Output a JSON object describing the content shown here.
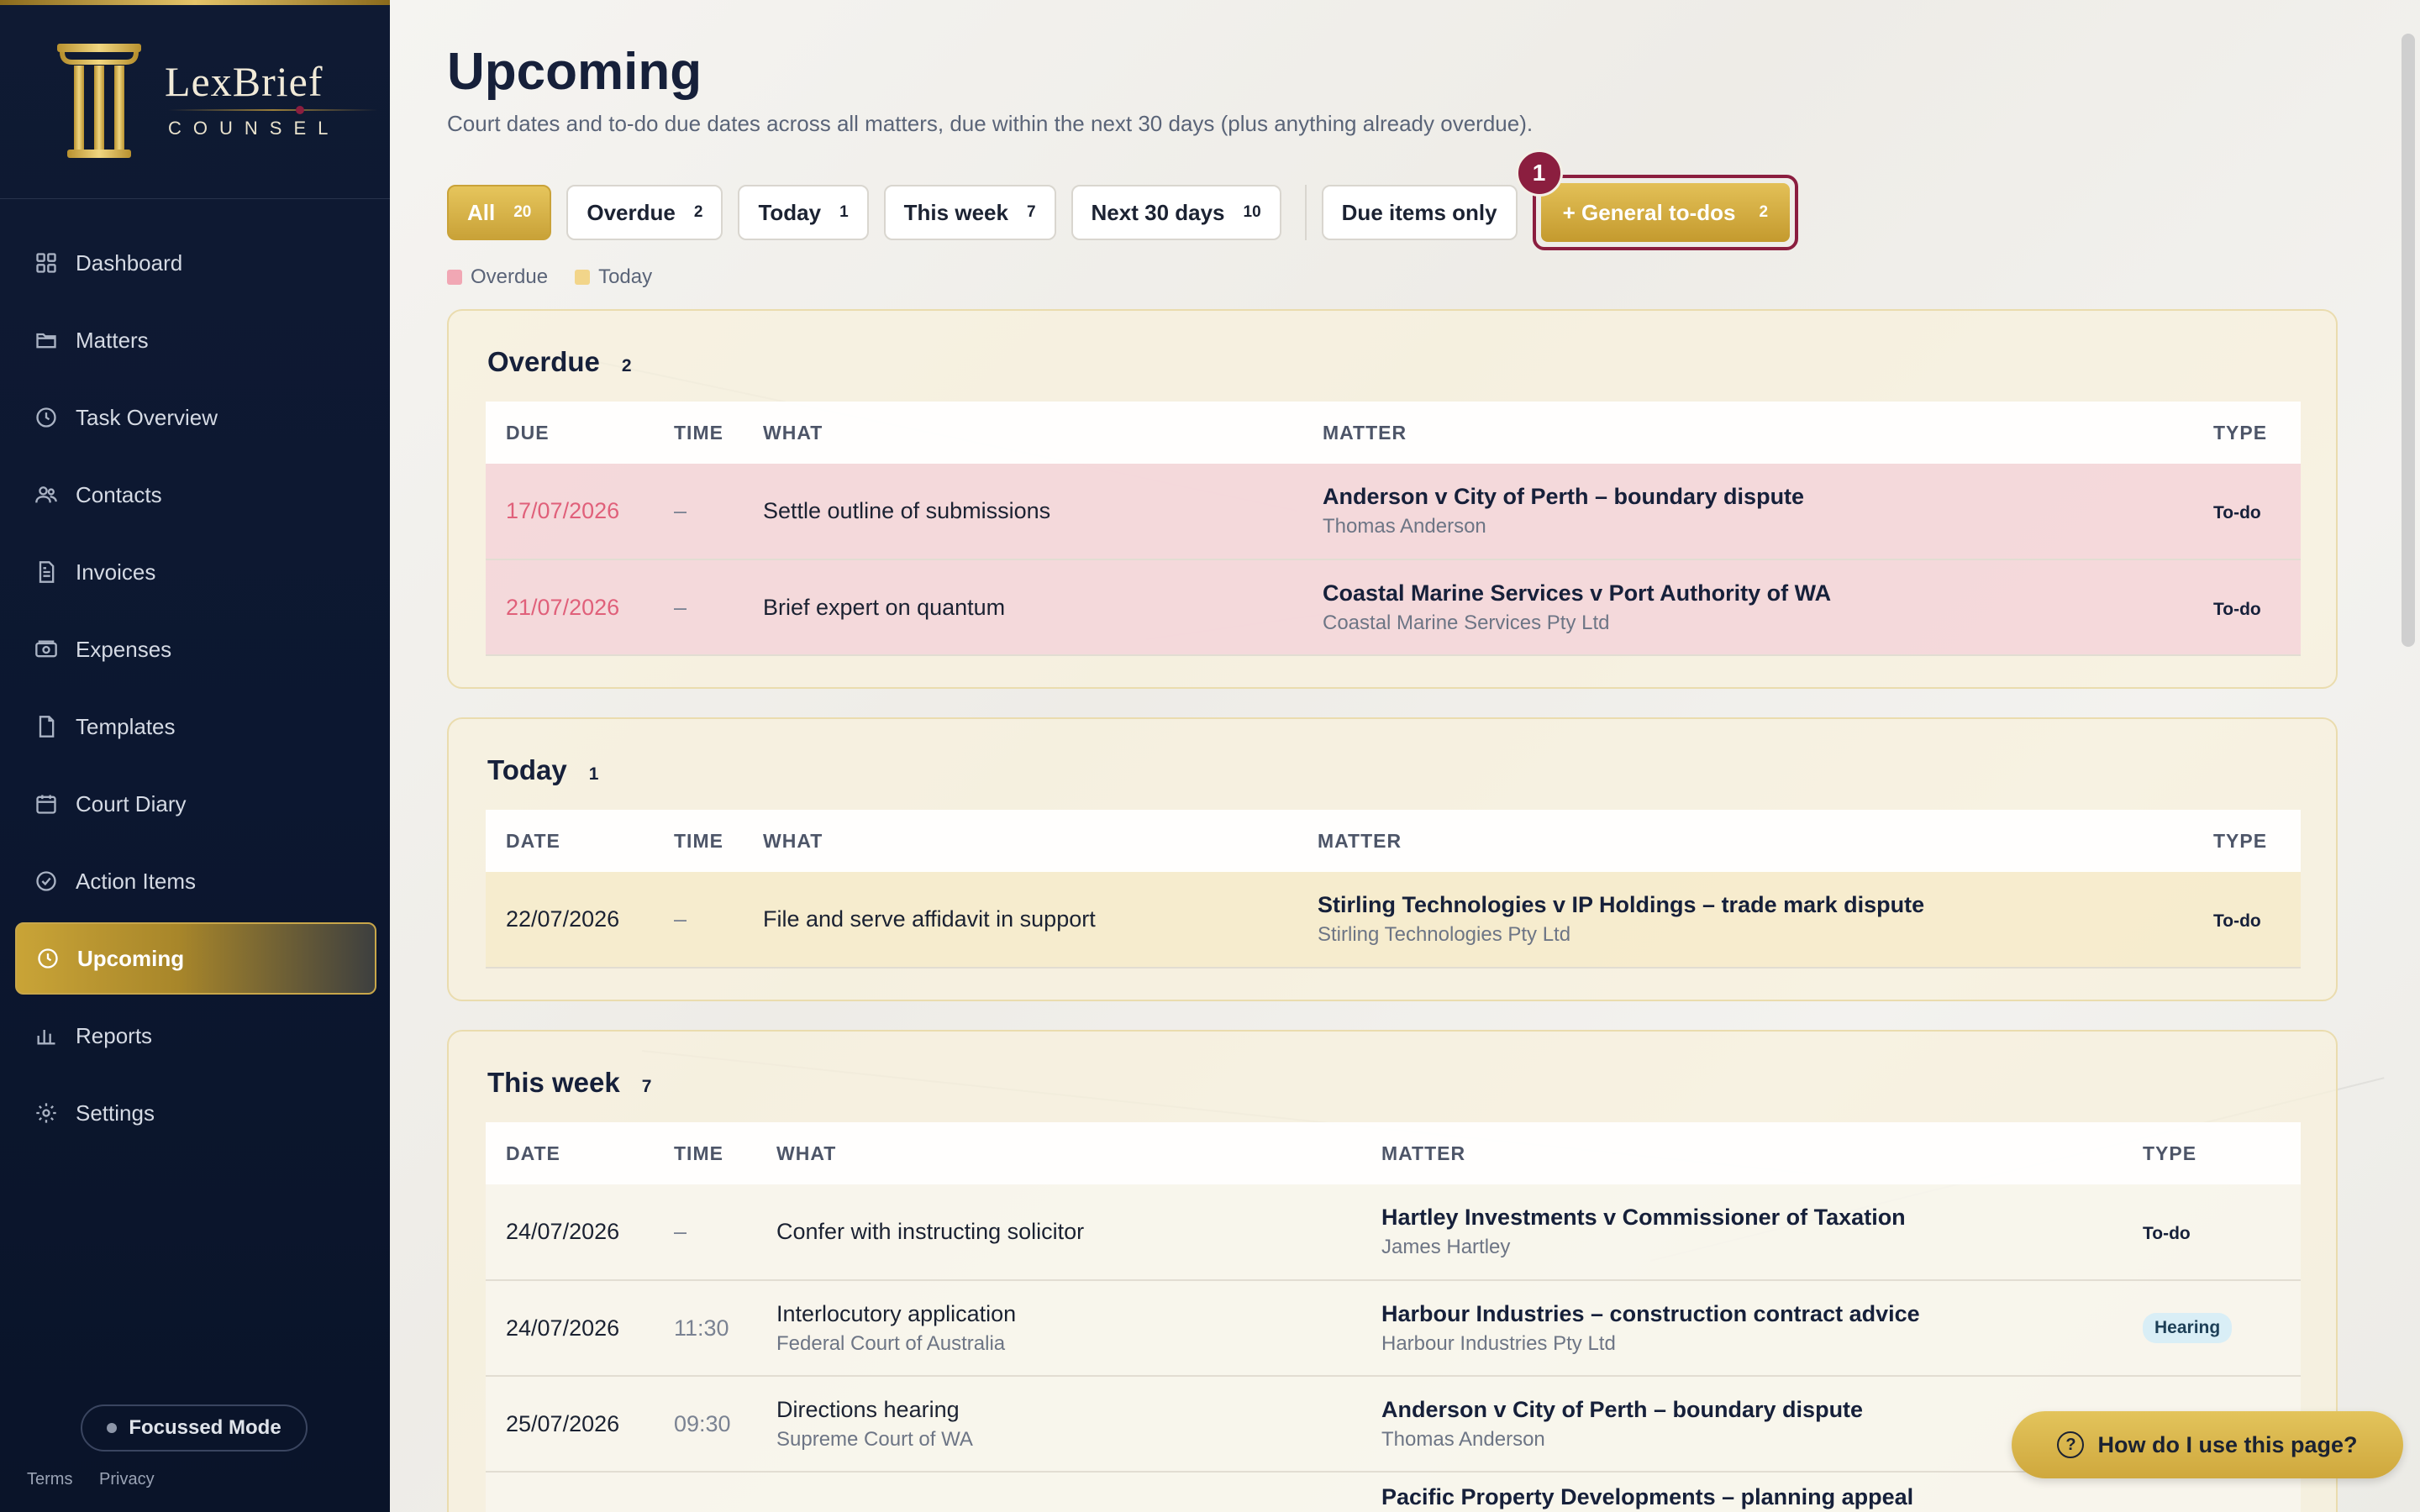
{
  "brand": {
    "name": "LexBrief",
    "sub": "COUNSEL"
  },
  "nav": [
    {
      "label": "Dashboard",
      "icon": "grid-icon"
    },
    {
      "label": "Matters",
      "icon": "folder-icon"
    },
    {
      "label": "Task Overview",
      "icon": "clock-icon"
    },
    {
      "label": "Contacts",
      "icon": "users-icon"
    },
    {
      "label": "Invoices",
      "icon": "invoice-icon"
    },
    {
      "label": "Expenses",
      "icon": "wallet-icon"
    },
    {
      "label": "Templates",
      "icon": "file-icon"
    },
    {
      "label": "Court Diary",
      "icon": "calendar-icon"
    },
    {
      "label": "Action Items",
      "icon": "check-circle-icon"
    },
    {
      "label": "Upcoming",
      "icon": "clock-icon",
      "active": true
    },
    {
      "label": "Reports",
      "icon": "bar-chart-icon"
    },
    {
      "label": "Settings",
      "icon": "gear-icon"
    }
  ],
  "focus_mode": "Focussed Mode",
  "footer": {
    "terms": "Terms",
    "privacy": "Privacy"
  },
  "page": {
    "title": "Upcoming",
    "subtitle": "Court dates and to-do due dates across all matters, due within the next 30 days (plus anything already overdue)."
  },
  "filters": [
    {
      "label": "All",
      "count": "20",
      "active": true
    },
    {
      "label": "Overdue",
      "count": "2"
    },
    {
      "label": "Today",
      "count": "1"
    },
    {
      "label": "This week",
      "count": "7"
    },
    {
      "label": "Next 30 days",
      "count": "10"
    }
  ],
  "due_only": "Due items only",
  "general_todos": {
    "label": "+ General to-dos",
    "count": "2",
    "badge": "1"
  },
  "legend": [
    {
      "label": "Overdue",
      "color": "#f1a7b4"
    },
    {
      "label": "Today",
      "color": "#f2d58a"
    }
  ],
  "colors": {
    "accent": "#c9a238",
    "maroon": "#8b1e3f",
    "overdue_text": "#e0607a"
  },
  "sections": {
    "overdue": {
      "title": "Overdue",
      "count": "2",
      "headers": [
        "DUE",
        "TIME",
        "WHAT",
        "MATTER",
        "TYPE"
      ],
      "rows": [
        {
          "date": "17/07/2026",
          "time": "–",
          "what": "Settle outline of submissions",
          "what2": "",
          "matter": "Anderson v City of Perth – boundary dispute",
          "client": "Thomas Anderson",
          "type": "To-do"
        },
        {
          "date": "21/07/2026",
          "time": "–",
          "what": "Brief expert on quantum",
          "what2": "",
          "matter": "Coastal Marine Services v Port Authority of WA",
          "client": "Coastal Marine Services Pty Ltd",
          "type": "To-do"
        }
      ]
    },
    "today": {
      "title": "Today",
      "count": "1",
      "headers": [
        "DATE",
        "TIME",
        "WHAT",
        "MATTER",
        "TYPE"
      ],
      "rows": [
        {
          "date": "22/07/2026",
          "time": "–",
          "what": "File and serve affidavit in support",
          "what2": "",
          "matter": "Stirling Technologies v IP Holdings – trade mark dispute",
          "client": "Stirling Technologies Pty Ltd",
          "type": "To-do"
        }
      ]
    },
    "week": {
      "title": "This week",
      "count": "7",
      "headers": [
        "DATE",
        "TIME",
        "WHAT",
        "MATTER",
        "TYPE"
      ],
      "rows": [
        {
          "date": "24/07/2026",
          "time": "–",
          "what": "Confer with instructing solicitor",
          "what2": "",
          "matter": "Hartley Investments v Commissioner of Taxation",
          "client": "James Hartley",
          "type": "To-do"
        },
        {
          "date": "24/07/2026",
          "time": "11:30",
          "what": "Interlocutory application",
          "what2": "Federal Court of Australia",
          "matter": "Harbour Industries – construction contract advice",
          "client": "Harbour Industries Pty Ltd",
          "type": "Hearing"
        },
        {
          "date": "25/07/2026",
          "time": "09:30",
          "what": "Directions hearing",
          "what2": "Supreme Court of WA",
          "matter": "Anderson v City of Perth – boundary dispute",
          "client": "Thomas Anderson",
          "type": ""
        },
        {
          "date": "",
          "time": "",
          "what": "",
          "what2": "",
          "matter": "Pacific Property Developments – planning appeal",
          "client": "",
          "type": ""
        }
      ]
    }
  },
  "help": "How do I use this page?"
}
